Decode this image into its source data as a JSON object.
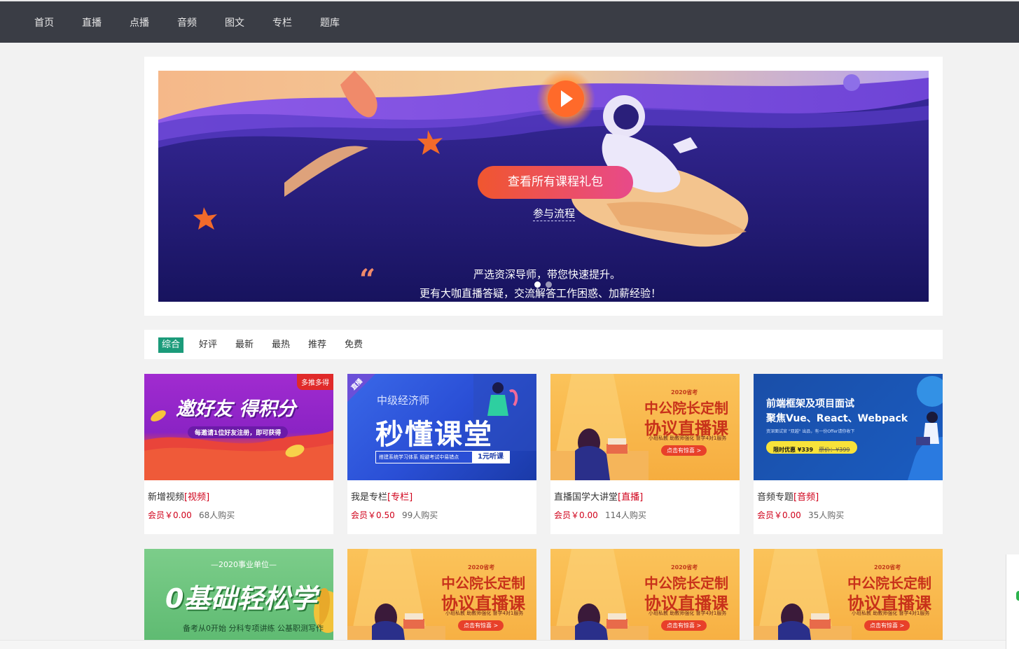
{
  "nav": {
    "items": [
      "首页",
      "直播",
      "点播",
      "音频",
      "图文",
      "专栏",
      "题库"
    ]
  },
  "banner": {
    "cta_label": "查看所有课程礼包",
    "flow_label": "参与流程",
    "quote_line1": "严选资深导师，带您快速提升。",
    "quote_line2": "更有大咖直播答疑，交流解答工作困惑、加薪经验！"
  },
  "filters": [
    "综合",
    "好评",
    "最新",
    "最热",
    "推荐",
    "免费"
  ],
  "cards": [
    {
      "title": "新增视频",
      "tag": "[视频]",
      "price": "会员￥0.00",
      "buyers": "68人购买",
      "thumb": {
        "headline": "邀好友 得积分",
        "sub": "每邀请1位好友注册，即可获得",
        "badge": "多推多得"
      }
    },
    {
      "title": "我是专栏",
      "tag": "[专栏]",
      "price": "会员￥0.50",
      "buyers": "99人购买",
      "thumb": {
        "corner": "直播",
        "small": "中级经济师",
        "headline": "秒懂课堂",
        "strip": "搭建系统学习体系 规避考试中易错点",
        "strip_btn": "1元听课"
      }
    },
    {
      "title": "直播国学大讲堂",
      "tag": "[直播]",
      "price": "会员￥0.00",
      "buyers": "114人购买",
      "thumb": {
        "year": "2020省考",
        "line1": "中公院长定制",
        "line2": "协议直播课",
        "features": "小班私教  助教师强化  督学4对1服务",
        "btn": "点击有惊喜 >"
      }
    },
    {
      "title": "音频专题",
      "tag": "[音频]",
      "price": "会员￥0.00",
      "buyers": "35人购买",
      "thumb": {
        "line1": "前端框架及项目面试",
        "line2": "聚焦Vue、React、Webpack",
        "small": "资深面试官 \"双越\" 出品，有一份Offer请你收下",
        "offer": "限时优惠 ¥339",
        "old_price": "原价：¥399"
      }
    },
    {
      "thumb": {
        "top": "—2020事业单位—",
        "headline": "0基础轻松学",
        "bottom": "备考从0开始 分科专项讲练 公基职测写作"
      }
    },
    {
      "thumb": {
        "year": "2020省考",
        "line1": "中公院长定制",
        "line2": "协议直播课",
        "features": "小班私教  助教师强化  督学4对1服务",
        "btn": "点击有惊喜 >"
      }
    },
    {
      "thumb": {
        "year": "2020省考",
        "line1": "中公院长定制",
        "line2": "协议直播课",
        "features": "小班私教  助教师强化  督学4对1服务",
        "btn": "点击有惊喜 >"
      }
    },
    {
      "thumb": {
        "year": "2020省考",
        "line1": "中公院长定制",
        "line2": "协议直播课",
        "features": "小班私教  助教师强化  督学4对1服务",
        "btn": "点击有惊喜 >"
      }
    }
  ]
}
